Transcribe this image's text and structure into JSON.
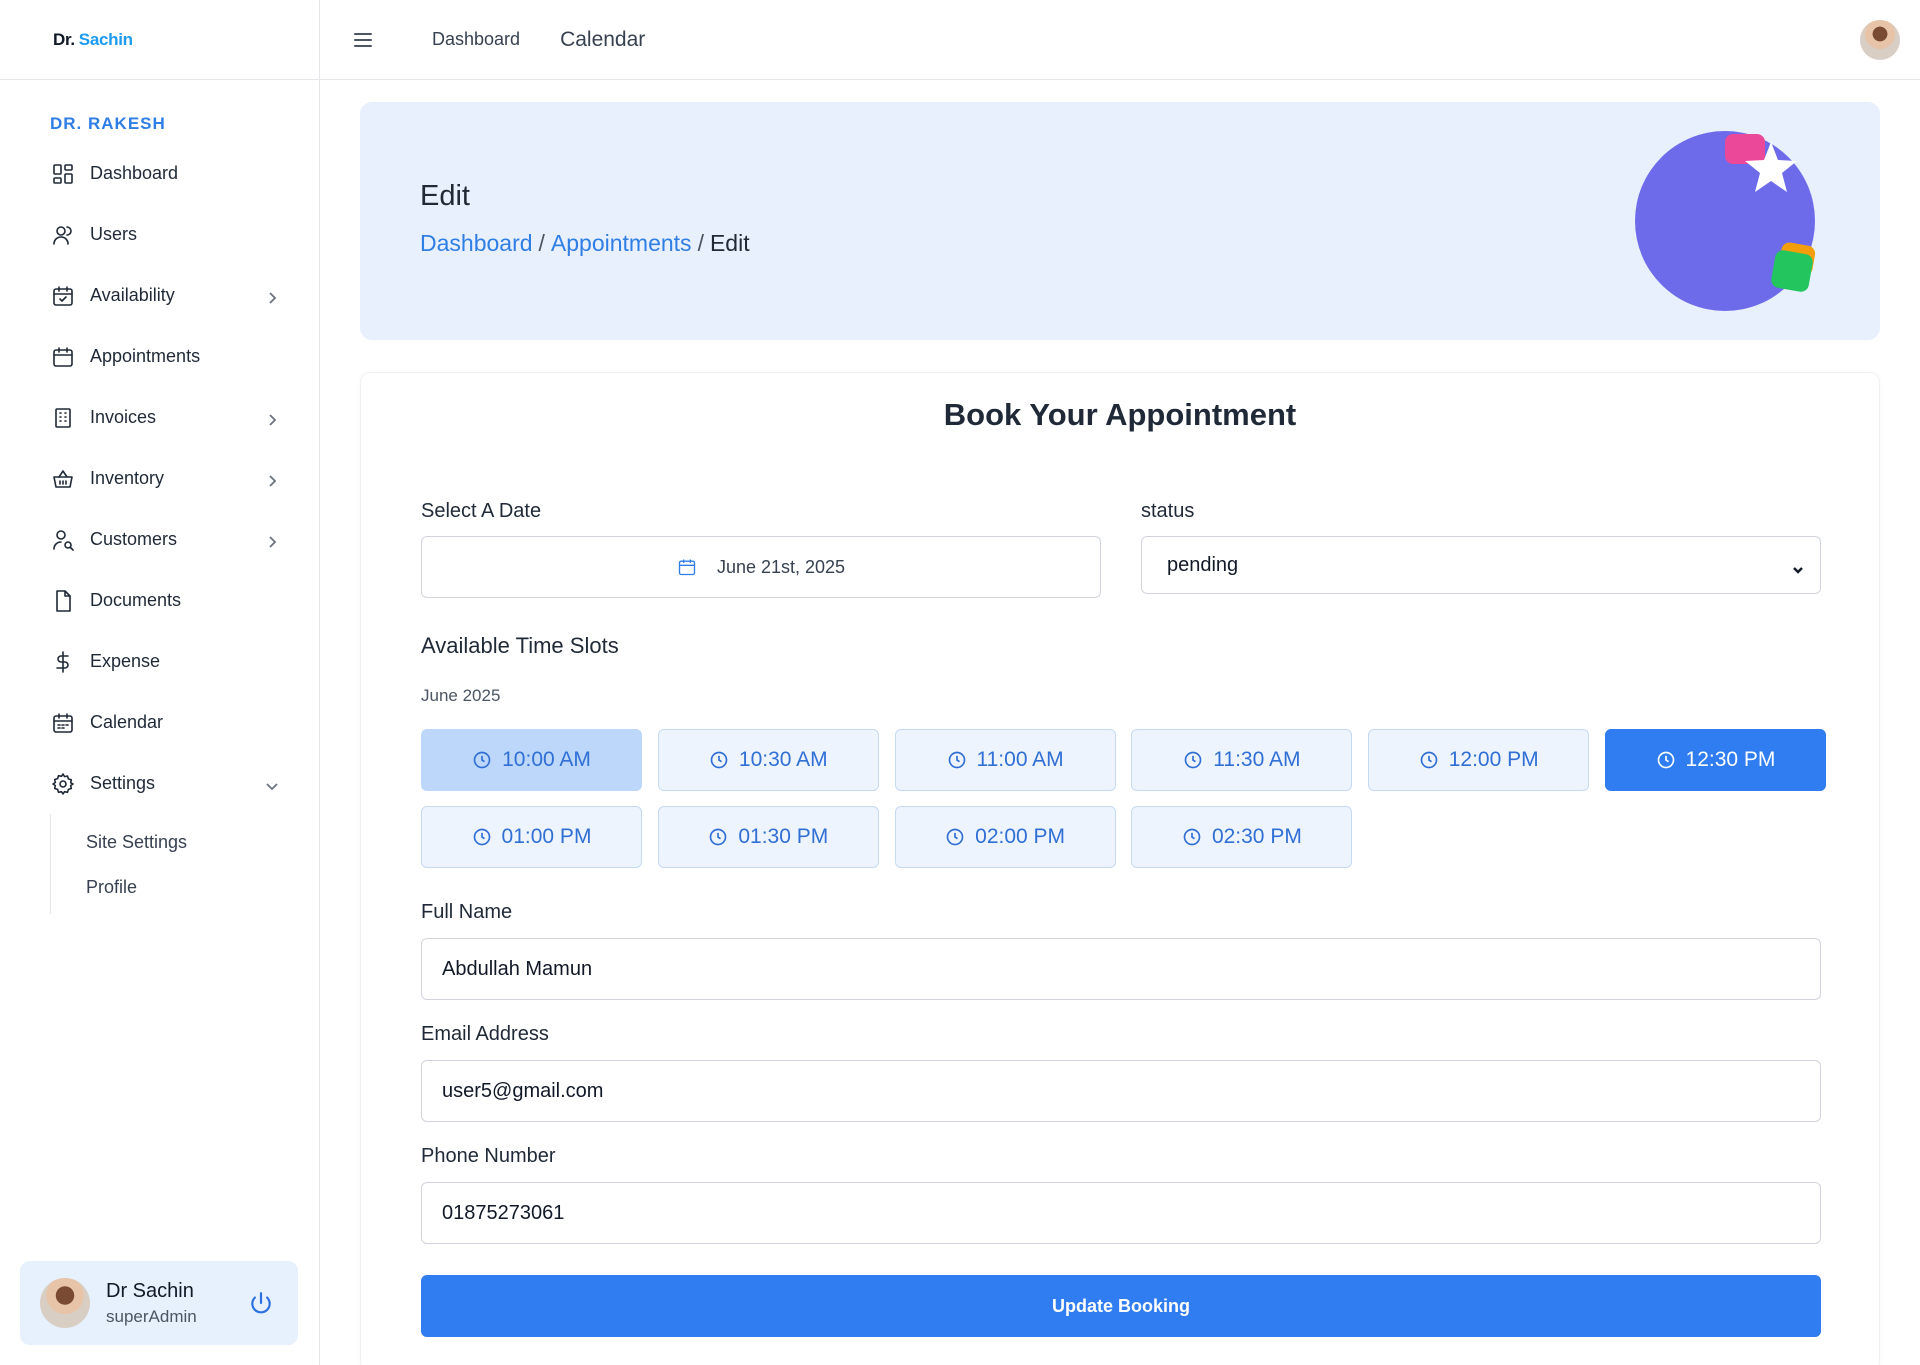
{
  "brand": {
    "part1": "Dr.",
    "part2": "Sachin"
  },
  "sidebar": {
    "section_title": "DR. RAKESH",
    "items": [
      {
        "label": "Dashboard",
        "icon": "dashboard-grid-icon"
      },
      {
        "label": "Users",
        "icon": "user-icon"
      },
      {
        "label": "Availability",
        "icon": "calendar-check-icon",
        "has_children": true
      },
      {
        "label": "Appointments",
        "icon": "calendar-icon"
      },
      {
        "label": "Invoices",
        "icon": "building-icon",
        "has_children": true
      },
      {
        "label": "Inventory",
        "icon": "basket-icon",
        "has_children": true
      },
      {
        "label": "Customers",
        "icon": "user-search-icon",
        "has_children": true
      },
      {
        "label": "Documents",
        "icon": "document-icon"
      },
      {
        "label": "Expense",
        "icon": "dollar-icon"
      },
      {
        "label": "Calendar",
        "icon": "calendar-days-icon"
      },
      {
        "label": "Settings",
        "icon": "gear-icon",
        "expanded": true
      }
    ],
    "settings_children": [
      "Site Settings",
      "Profile"
    ],
    "user": {
      "name": "Dr Sachin",
      "role": "superAdmin"
    }
  },
  "topbar": {
    "link1": "Dashboard",
    "link2": "Calendar"
  },
  "header": {
    "title": "Edit",
    "breadcrumbs": [
      "Dashboard",
      "Appointments",
      "Edit"
    ],
    "separator": "/"
  },
  "form": {
    "title": "Book Your Appointment",
    "date_label": "Select A Date",
    "date_value": "June 21st, 2025",
    "status_label": "status",
    "status_value": "pending",
    "slots_title": "Available Time Slots",
    "month": "June 2025",
    "slots": [
      "10:00 AM",
      "10:30 AM",
      "11:00 AM",
      "11:30 AM",
      "12:00 PM",
      "12:30 PM",
      "01:00 PM",
      "01:30 PM",
      "02:00 PM",
      "02:30 PM"
    ],
    "full_name_label": "Full Name",
    "full_name_value": "Abdullah Mamun",
    "email_label": "Email Address",
    "email_value": "user5@gmail.com",
    "phone_label": "Phone Number",
    "phone_value": "01875273061",
    "submit_label": "Update Booking"
  },
  "colors": {
    "primary": "#2f7df0",
    "banner_bg": "#e7f0fc",
    "slot_bg": "#eef4fd",
    "link": "#2f7ee6"
  }
}
